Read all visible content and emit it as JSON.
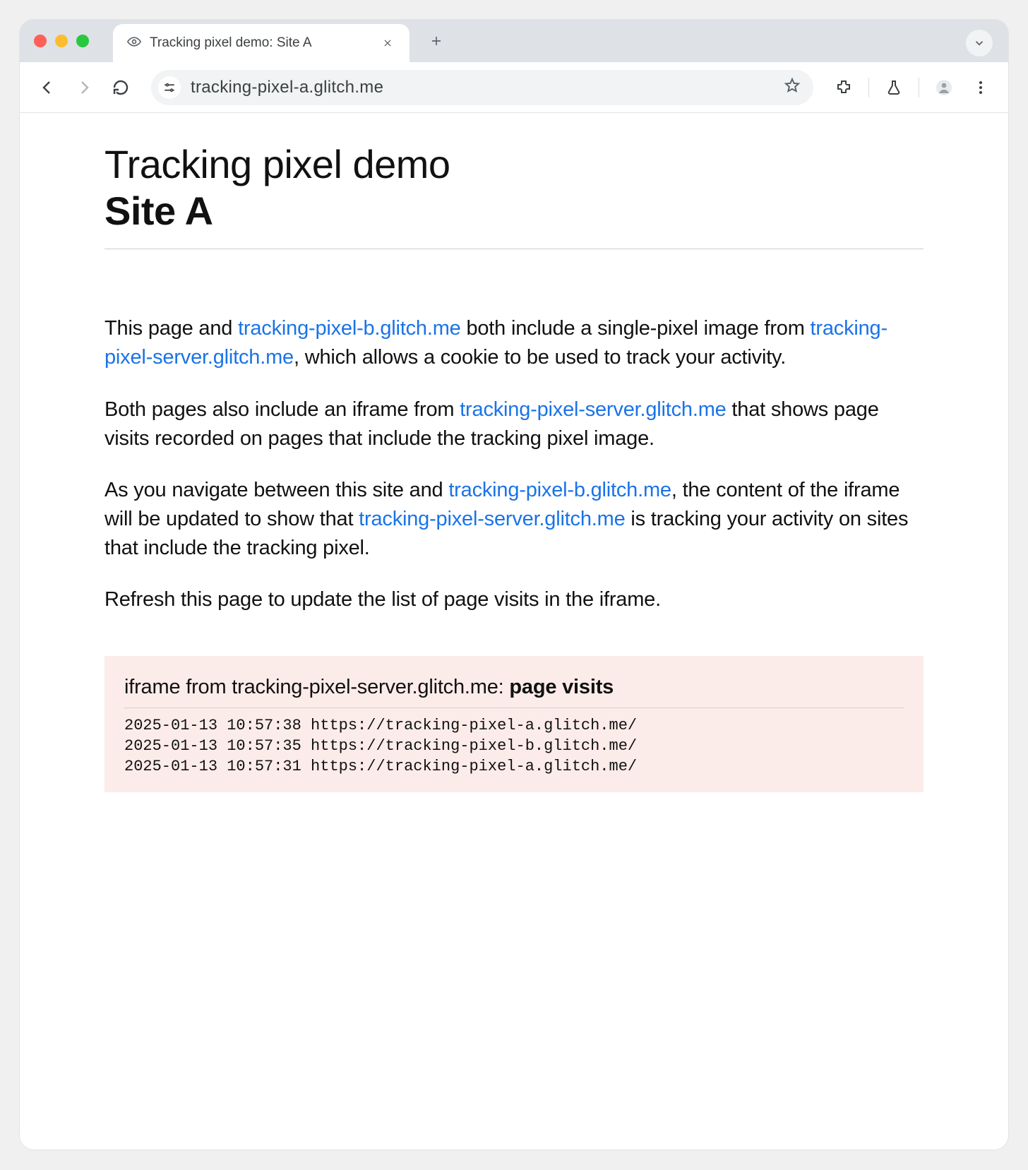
{
  "browser": {
    "tab_title": "Tracking pixel demo: Site A",
    "url": "tracking-pixel-a.glitch.me"
  },
  "page": {
    "heading_line1": "Tracking pixel demo",
    "heading_line2": "Site A",
    "p1_a": "This page and ",
    "p1_link1": "tracking-pixel-b.glitch.me",
    "p1_b": " both include a single-pixel image from ",
    "p1_link2": "tracking-pixel-server.glitch.me",
    "p1_c": ", which allows a cookie to be used to track your activity.",
    "p2_a": "Both pages also include an iframe from ",
    "p2_link1": "tracking-pixel-server.glitch.me",
    "p2_b": " that shows page visits recorded on pages that include the tracking pixel image.",
    "p3_a": "As you navigate between this site and ",
    "p3_link1": "tracking-pixel-b.glitch.me",
    "p3_b": ", the content of the iframe will be updated to show that ",
    "p3_link2": "tracking-pixel-server.glitch.me",
    "p3_c": " is tracking your activity on sites that include the tracking pixel.",
    "p4": "Refresh this page to update the list of page visits in the iframe."
  },
  "iframe": {
    "heading_a": "iframe from tracking-pixel-server.glitch.me: ",
    "heading_b": "page visits",
    "log": [
      "2025-01-13 10:57:38 https://tracking-pixel-a.glitch.me/",
      "2025-01-13 10:57:35 https://tracking-pixel-b.glitch.me/",
      "2025-01-13 10:57:31 https://tracking-pixel-a.glitch.me/"
    ]
  }
}
